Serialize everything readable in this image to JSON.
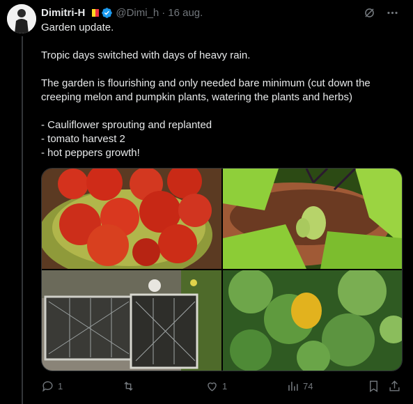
{
  "tweet": {
    "author_name": "Dimitri-H",
    "handle": "@Dimi_h",
    "separator": "·",
    "date": "16 aug.",
    "verified": true,
    "flag_colors": [
      "#000000",
      "#fdda24",
      "#ef3340"
    ],
    "text": "Garden update.\n\nTropic days switched with days of heavy rain.\n\nThe garden is flourishing and only needed bare minimum (cut down the creeping melon and pumpkin plants, watering the plants and herbs)\n\n- Cauliflower sprouting and replanted\n- tomato harvest 2\n- hot peppers growth!"
  },
  "media": [
    {
      "subject": "bowl of ripe red tomatoes"
    },
    {
      "subject": "pepper plant with small green hot peppers"
    },
    {
      "subject": "wire mesh seedling cages in garden"
    },
    {
      "subject": "pumpkin plant leaves with yellow fruit"
    }
  ],
  "actions": {
    "reply_count": "1",
    "retweet_count": "",
    "like_count": "1",
    "view_count": "74"
  },
  "colors": {
    "accent": "#1d9bf0",
    "muted": "#71767b",
    "text": "#e7e9ea",
    "background": "#000000"
  }
}
